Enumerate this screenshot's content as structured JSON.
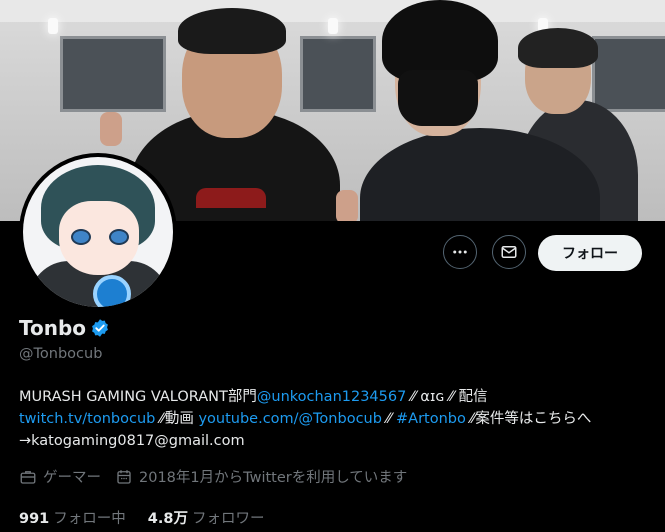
{
  "profile": {
    "name": "Tonbo",
    "handle": "@Tonbocub",
    "verified": true
  },
  "actions": {
    "more_icon": "more-horizontal-icon",
    "message_icon": "mail-icon",
    "follow_label": "フォロー"
  },
  "bio": {
    "segments": [
      {
        "text": "MURASH GAMING VALORANT部門",
        "type": "text"
      },
      {
        "text": "@unkochan1234567",
        "type": "link"
      },
      {
        "text": " ⁄⁄ ⍺ɪɢ ⁄⁄ 配信",
        "type": "text"
      },
      {
        "text": "twitch.tv/tonbocub",
        "type": "link"
      },
      {
        "text": " ⁄⁄動画 ",
        "type": "text"
      },
      {
        "text": "youtube.com/@Tonbocub",
        "type": "link"
      },
      {
        "text": " ⁄⁄ ",
        "type": "text"
      },
      {
        "text": "#Artonbo",
        "type": "link"
      },
      {
        "text": " ⁄⁄案件等はこちらへ→katogaming0817@gmail.com",
        "type": "text"
      }
    ]
  },
  "meta": {
    "category": "ゲーマー",
    "joined": "2018年1月からTwitterを利用しています"
  },
  "stats": {
    "following_count": "991",
    "following_label": "フォロー中",
    "followers_count": "4.8万",
    "followers_label": "フォロワー"
  },
  "colors": {
    "accent": "#1d9bf0",
    "background": "#000000",
    "muted": "#71767b"
  }
}
